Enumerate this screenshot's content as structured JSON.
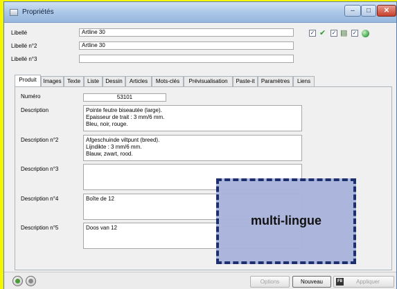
{
  "window": {
    "title": "Propriétés",
    "minimize": "–",
    "maximize": "□",
    "close": "✕"
  },
  "header": {
    "libelle": {
      "label": "Libellé",
      "value": "Artline 30"
    },
    "libelle2": {
      "label": "Libellé n°2",
      "value": "Artline 30"
    },
    "libelle3": {
      "label": "Libellé n°3",
      "value": ""
    }
  },
  "flags": {
    "checkbox_mark": "✓",
    "check_icon": "✔",
    "list_icon": "▤"
  },
  "tabs": [
    "Produit",
    "Images",
    "Texte",
    "Liste",
    "Dessin",
    "Articles",
    "Mots-clés",
    "Prévisualisation",
    "Paste-it",
    "Paramètres",
    "Liens"
  ],
  "produit": {
    "numero": {
      "label": "Numéro",
      "value": "53101"
    },
    "description": {
      "label": "Description",
      "lines": [
        "Pointe feutre biseautée (large).",
        "Epaisseur de trait : 3 mm/6 mm.",
        "Bleu, noir, rouge."
      ]
    },
    "description2": {
      "label": "Description n°2",
      "lines": [
        "Afgeschuinde viltpunt (breed).",
        "Lijndikte : 3 mm/6 mm.",
        "Blauw, zwart, rood."
      ]
    },
    "description3": {
      "label": "Description n°3",
      "lines": []
    },
    "description4": {
      "label": "Description n°4",
      "lines": [
        "Boîte de 12"
      ]
    },
    "description5": {
      "label": "Description n°5",
      "lines": [
        "Doos van 12"
      ]
    }
  },
  "footer": {
    "options": "Options",
    "nouveau": "Nouveau",
    "fkey": "F8",
    "appliquer": "Appliquer"
  },
  "overlay": {
    "text": "multi-lingue"
  },
  "colors": {
    "accent": "#1e2f6e",
    "overlay_fill": "#a9b4db",
    "desktop": "#f5f500"
  }
}
